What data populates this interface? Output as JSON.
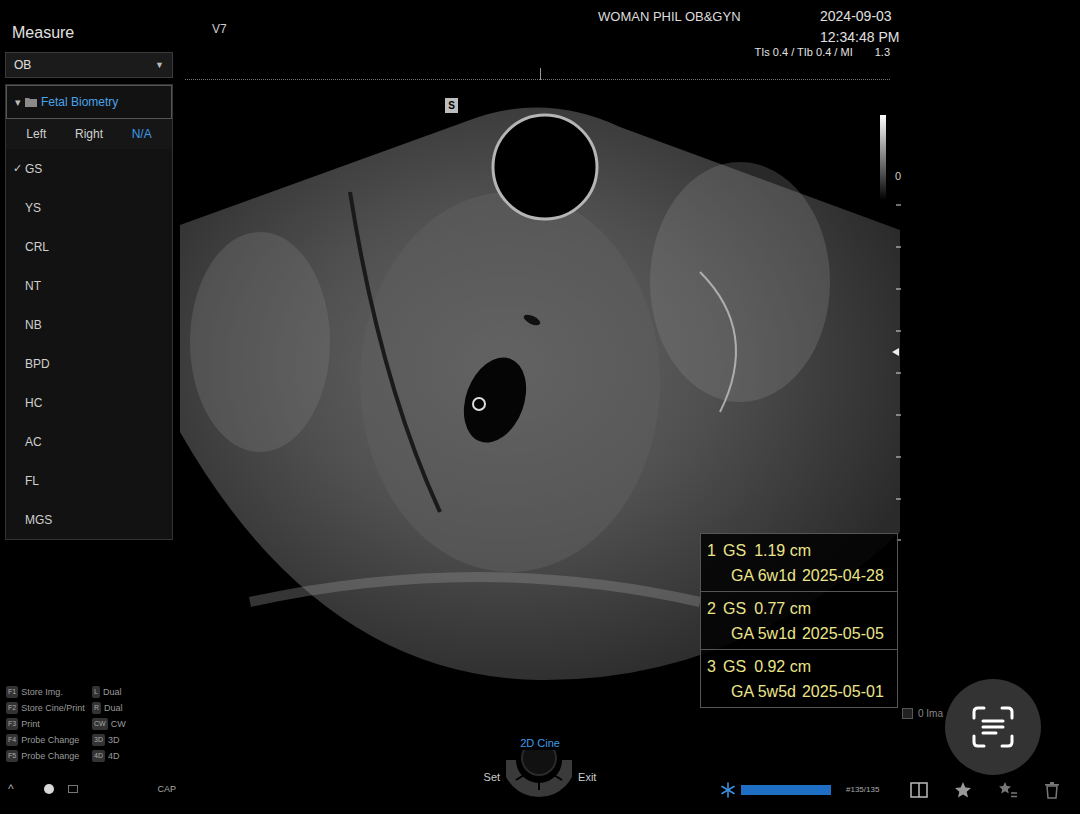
{
  "header": {
    "probe": "V7",
    "institution": "WOMAN PHIL OB&GYN",
    "date": "2024-09-03",
    "time": "12:34:48 PM",
    "indices": "TIs 0.4 / TIb 0.4 / MI",
    "mi": "1.3"
  },
  "sidebar": {
    "title": "Measure",
    "dropdown": "OB",
    "dropdown_caret": "▼",
    "folder": {
      "label": "Fetal Biometry",
      "caret": "▾",
      "expanded": true
    },
    "sides": [
      {
        "label": "Left",
        "selected": false
      },
      {
        "label": "Right",
        "selected": false
      },
      {
        "label": "N/A",
        "selected": true
      }
    ],
    "check_mark": "✓",
    "items": [
      {
        "label": "GS",
        "checked": true
      },
      {
        "label": "YS",
        "checked": false
      },
      {
        "label": "CRL",
        "checked": false
      },
      {
        "label": "NT",
        "checked": false
      },
      {
        "label": "NB",
        "checked": false
      },
      {
        "label": "BPD",
        "checked": false
      },
      {
        "label": "HC",
        "checked": false
      },
      {
        "label": "AC",
        "checked": false
      },
      {
        "label": "FL",
        "checked": false
      },
      {
        "label": "MGS",
        "checked": false
      }
    ]
  },
  "image": {
    "orientation_marker": "S",
    "grayscale_label": "0"
  },
  "measurements": [
    {
      "index": "1",
      "name": "GS",
      "value": "1.19 cm",
      "ga": "GA 6w1d",
      "edd": "2025-04-28"
    },
    {
      "index": "2",
      "name": "GS",
      "value": "0.77 cm",
      "ga": "GA 5w1d",
      "edd": "2025-05-05"
    },
    {
      "index": "3",
      "name": "GS",
      "value": "0.92 cm",
      "ga": "GA 5w5d",
      "edd": "2025-05-01"
    }
  ],
  "image_count": {
    "label": "0 Ima",
    "checked": false
  },
  "keys": [
    {
      "key": "F1",
      "label": "Store Img.",
      "side_key": "L",
      "side_label": "Dual"
    },
    {
      "key": "F2",
      "label": "Store Cine/Print",
      "side_key": "R",
      "side_label": "Dual"
    },
    {
      "key": "F3",
      "label": "Print",
      "side_key": "CW",
      "side_label": "CW"
    },
    {
      "key": "F4",
      "label": "Probe Change",
      "side_key": "3D",
      "side_label": "3D"
    },
    {
      "key": "F5",
      "label": "Probe Change",
      "side_key": "4D",
      "side_label": "4D"
    }
  ],
  "status": {
    "caret": "^",
    "caps": "CAP"
  },
  "cine": {
    "mode": "2D Cine",
    "set": "Set",
    "exit": "Exit",
    "frame": "#135/135",
    "level": 1
  }
}
